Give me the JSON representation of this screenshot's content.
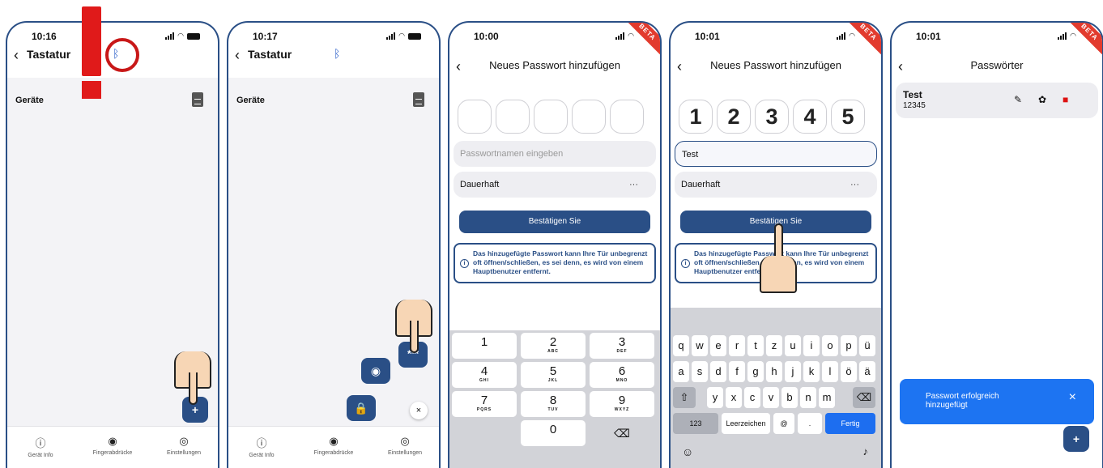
{
  "status": {
    "times": [
      "10:16",
      "10:17",
      "10:00",
      "10:01",
      "10:01"
    ]
  },
  "beta_badge": "BETA",
  "screen1": {
    "title": "Tastatur",
    "devices_label": "Geräte",
    "fab_plus": "+"
  },
  "screen2": {
    "title": "Tastatur",
    "devices_label": "Geräte",
    "close": "×"
  },
  "nav": {
    "items": [
      "Gerät Info",
      "Fingerabdrücke",
      "Einstellungen"
    ]
  },
  "add_password": {
    "title": "Neues Passwort hinzufügen",
    "name_placeholder": "Passwortnamen eingeben",
    "duration": "Dauerhaft",
    "dots": "···",
    "confirm": "Bestätigen Sie",
    "info": "Das hinzugefügte Passwort kann Ihre Tür unbegrenzt oft öffnen/schließen, es sei denn, es wird von einem Hauptbenutzer entfernt."
  },
  "add_password_filled": {
    "digits": [
      "1",
      "2",
      "3",
      "4",
      "5"
    ],
    "name": "Test"
  },
  "numpad": {
    "keys": [
      {
        "d": "1",
        "l": ""
      },
      {
        "d": "2",
        "l": "ABC"
      },
      {
        "d": "3",
        "l": "DEF"
      },
      {
        "d": "4",
        "l": "GHI"
      },
      {
        "d": "5",
        "l": "JKL"
      },
      {
        "d": "6",
        "l": "MNO"
      },
      {
        "d": "7",
        "l": "PQRS"
      },
      {
        "d": "8",
        "l": "TUV"
      },
      {
        "d": "9",
        "l": "WXYZ"
      },
      {
        "d": "0",
        "l": ""
      }
    ]
  },
  "keyboard": {
    "row1": [
      "q",
      "w",
      "e",
      "r",
      "t",
      "z",
      "u",
      "i",
      "o",
      "p",
      "ü"
    ],
    "row2": [
      "a",
      "s",
      "d",
      "f",
      "g",
      "h",
      "j",
      "k",
      "l",
      "ö",
      "ä"
    ],
    "row3": [
      "y",
      "x",
      "c",
      "v",
      "b",
      "n",
      "m"
    ],
    "num": "123",
    "space": "Leerzeichen",
    "at": "@",
    "dot": ".",
    "done": "Fertig"
  },
  "passwords": {
    "title": "Passwörter",
    "entries": [
      {
        "name": "Test",
        "code": "12345"
      }
    ],
    "toast": "Passwort erfolgreich hinzugefügt",
    "toast_close": "×",
    "fab_plus": "+"
  }
}
